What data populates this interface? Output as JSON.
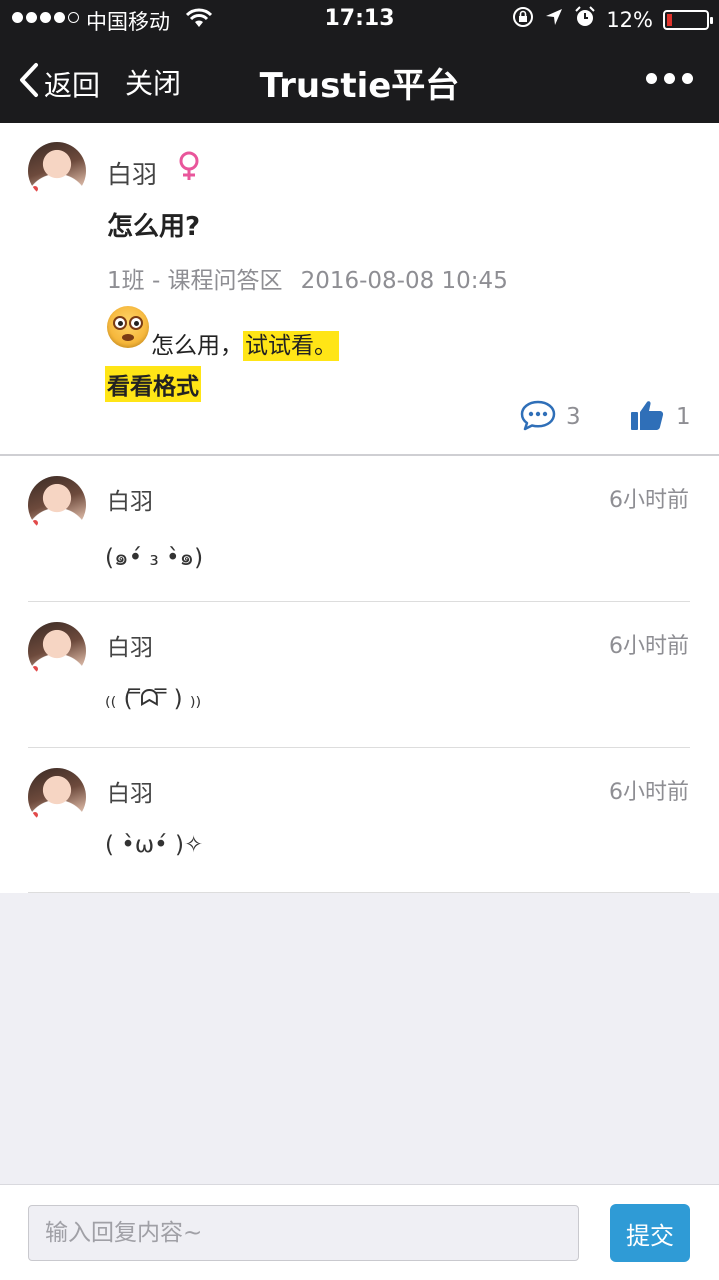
{
  "status_bar": {
    "carrier": "中国移动",
    "time": "17:13",
    "battery_percent": "12%",
    "signal_bars_filled": 4,
    "signal_bars_total": 5
  },
  "nav": {
    "back_label": "返回",
    "close_label": "关闭",
    "title": "Trustie平台"
  },
  "post": {
    "author": "白羽",
    "title": "怎么用?",
    "meta_course": "1班 - 课程问答区",
    "meta_time": "2016-08-08 10:45",
    "body_text": "怎么用，",
    "body_highlight": "试试看。",
    "body_line2": "看看格式",
    "comment_count": "3",
    "like_count": "1",
    "highlight_color": "#ffe516"
  },
  "replies": [
    {
      "author": "白羽",
      "time": "6小时前",
      "text": "(๑•́ ₃ •̀๑)"
    },
    {
      "author": "白羽",
      "time": "6小时前",
      "text": "₍₍ ( ̿ᗣ ̿ ) ₎₎"
    },
    {
      "author": "白羽",
      "time": "6小时前",
      "text": "( •̀ω•́ )✧"
    }
  ],
  "composer": {
    "placeholder": "输入回复内容~",
    "submit_label": "提交",
    "accent_color": "#2f9bd6"
  }
}
